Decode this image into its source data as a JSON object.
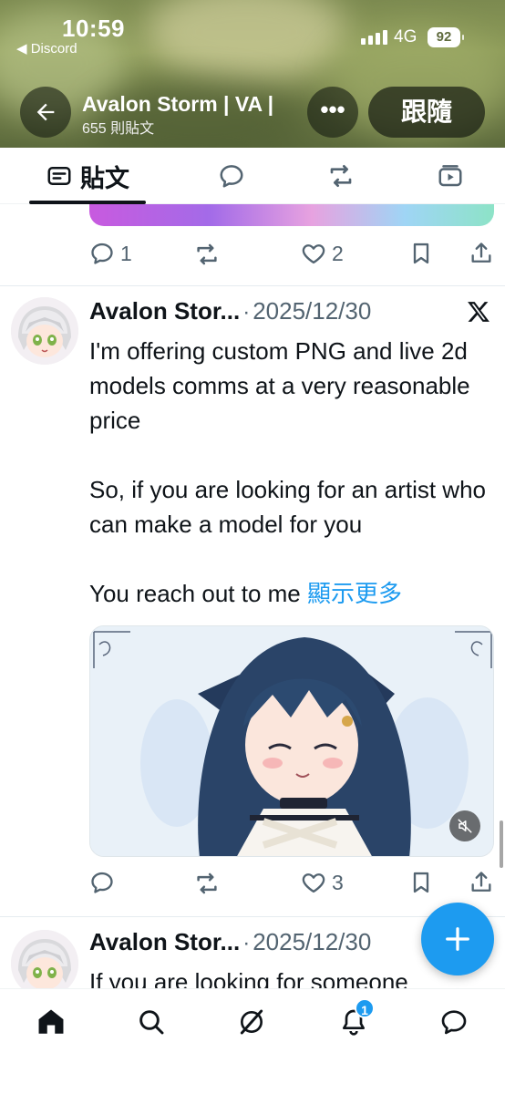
{
  "status_bar": {
    "time": "10:59",
    "back_app": "◀ Discord",
    "network": "4G",
    "battery": "92"
  },
  "header": {
    "profile_name": "Avalon Storm | VA |",
    "post_count": "655 則貼文",
    "more_label": "•••",
    "follow_label": "跟隨"
  },
  "tabs": [
    {
      "label": "貼文",
      "icon": "posts-icon"
    },
    {
      "icon": "replies-icon"
    },
    {
      "icon": "retweets-icon"
    },
    {
      "icon": "media-icon"
    }
  ],
  "feed": {
    "previous_tweet_actions": {
      "replies": "1",
      "likes": "2"
    },
    "tweet_1": {
      "author": "Avalon Stor...",
      "separator": "·",
      "date": "2025/12/30",
      "lines": [
        "I'm offering custom PNG and live 2d models comms at a very reasonable price",
        "So, if you are looking for an artist who can make a model for you",
        "You reach out to me "
      ],
      "show_more": "顯示更多",
      "actions": {
        "likes": "3"
      }
    },
    "tweet_2": {
      "author": "Avalon Stor...",
      "separator": "·",
      "date": "2025/12/30",
      "text": "If you are looking for someone"
    }
  },
  "fab": {
    "label": "+"
  },
  "bottom_nav": {
    "notifications_badge": "1"
  },
  "colors": {
    "accent": "#1d9bf0",
    "text": "#0f1419",
    "muted": "#536471"
  }
}
